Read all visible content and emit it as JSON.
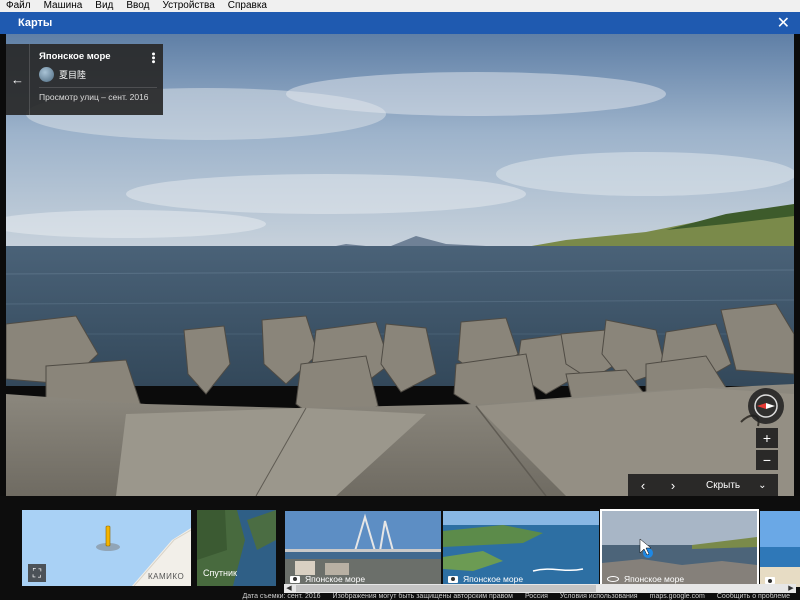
{
  "menubar": {
    "items": [
      "Файл",
      "Машина",
      "Вид",
      "Ввод",
      "Устройства",
      "Справка"
    ]
  },
  "window": {
    "title": "Карты",
    "close_icon": "close-icon"
  },
  "info_card": {
    "title": "Японское море",
    "user": "夏目陸",
    "date": "Просмотр улиц – сент. 2016"
  },
  "controls": {
    "zoom_in": "+",
    "zoom_out": "−",
    "hide_label": "Скрыть"
  },
  "filmstrip": {
    "satellite_label": "Спутник",
    "map_city_label": "КАМИКО",
    "thumbnails": [
      {
        "caption": "Японское море",
        "type": "photo"
      },
      {
        "caption": "Японское море",
        "type": "photo"
      },
      {
        "caption": "Японское море",
        "type": "panorama",
        "selected": true
      },
      {
        "caption": "",
        "type": "photo"
      }
    ]
  },
  "footer": {
    "items": [
      "Дата съемки: сент. 2016",
      "Изображения могут быть защищены авторским правом",
      "Россия",
      "Условия использования",
      "maps.google.com",
      "Сообщить о проблеме"
    ]
  },
  "colors": {
    "titlebar": "#1f5ab0",
    "panel": "#282828",
    "pin": "#f5b400",
    "compass_red": "#e53935"
  }
}
